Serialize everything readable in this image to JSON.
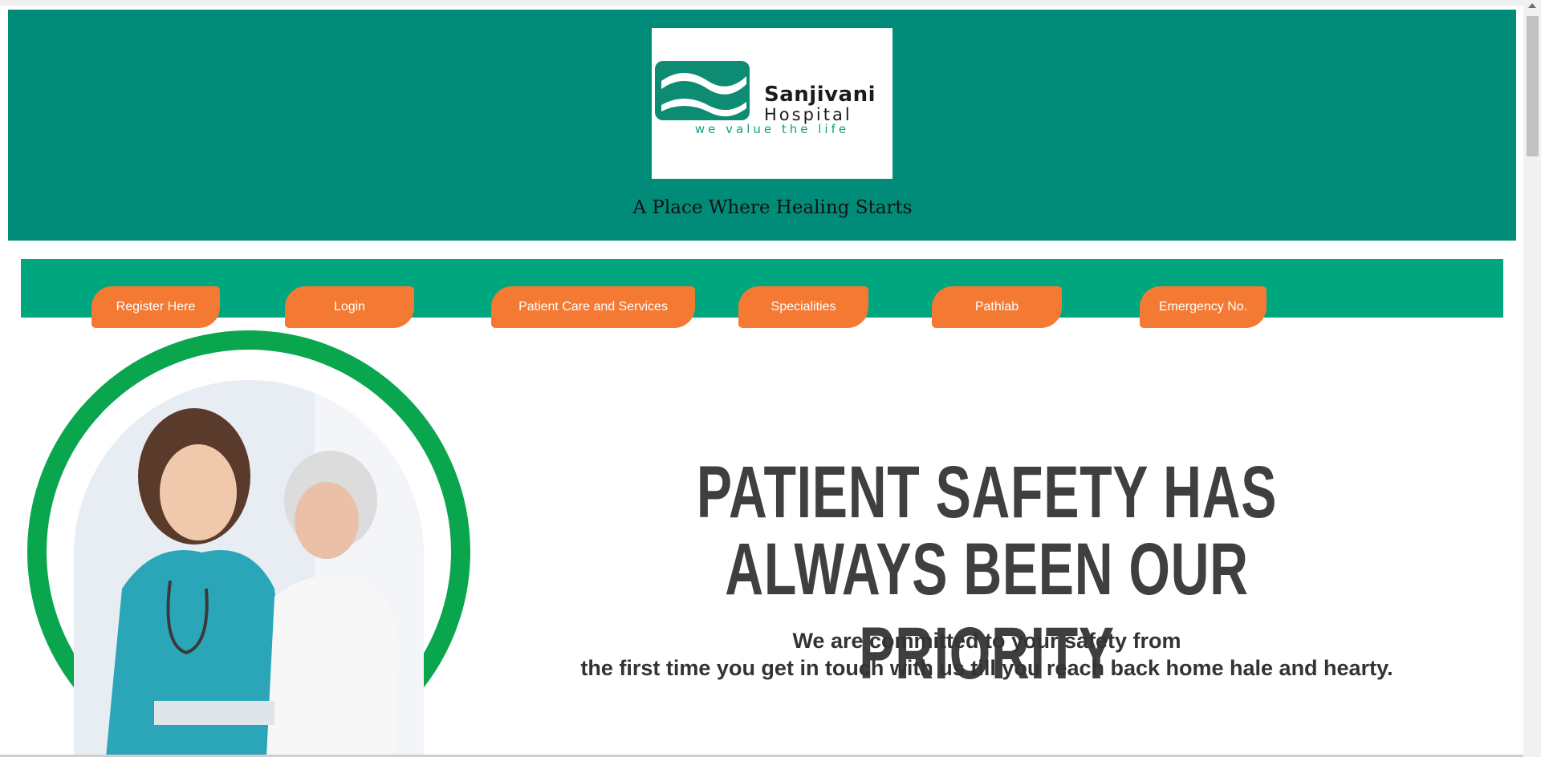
{
  "header": {
    "logo": {
      "name": "Sanjivani",
      "subname": "Hospital",
      "tagline": "we value the life"
    },
    "tagline": "A Place Where Healing Starts"
  },
  "nav": {
    "items": [
      {
        "label": "Register Here"
      },
      {
        "label": "Login"
      },
      {
        "label": "Patient Care and Services"
      },
      {
        "label": "Specialities"
      },
      {
        "label": "Pathlab"
      },
      {
        "label": "Emergency No."
      }
    ]
  },
  "hero": {
    "headline_line1": "PATIENT SAFETY HAS",
    "headline_line2": "ALWAYS BEEN OUR PRIORITY",
    "subline1": "We are committed to your safety from",
    "subline2": "the first time you get in touch with us till you reach back home hale and hearty."
  },
  "colors": {
    "header_bg": "#008c79",
    "nav_bg": "#00a77e",
    "button_bg": "#f47a33",
    "ring": "#0aa64e"
  }
}
